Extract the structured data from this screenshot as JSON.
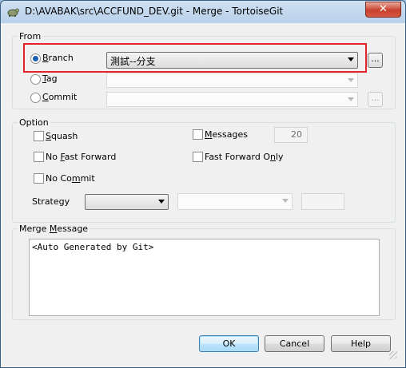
{
  "window": {
    "title": "D:\\AVABAK\\src\\ACCFUND_DEV.git - Merge - TortoiseGit",
    "close_label": "✕"
  },
  "from": {
    "label": "From",
    "branch": {
      "label_u": "B",
      "label_rest": "ranch",
      "value": "測試--分支",
      "checked": true
    },
    "tag": {
      "label_u": "T",
      "label_rest": "ag",
      "value": ""
    },
    "commit": {
      "label_u": "C",
      "label_rest": "ommit",
      "value": ""
    },
    "browse_label": "..."
  },
  "option": {
    "label": "Option",
    "squash": {
      "label_u": "S",
      "label_rest": "quash"
    },
    "messages": {
      "label_u": "M",
      "label_rest": "essages",
      "value": "20"
    },
    "no_fast_forward": {
      "pre": "No ",
      "u": "F",
      "post": "ast Forward"
    },
    "fast_forward_only": {
      "pre": "Fast Forward O",
      "u": "n",
      "post": "ly"
    },
    "no_commit": {
      "pre": "No Co",
      "u": "m",
      "post": "mit"
    },
    "strategy_label": "Strategy"
  },
  "merge_message": {
    "label_pre": "Merge ",
    "label_u": "M",
    "label_post": "essage",
    "value": "<Auto Generated by Git>"
  },
  "buttons": {
    "ok": "OK",
    "cancel": "Cancel",
    "help": "Help"
  }
}
